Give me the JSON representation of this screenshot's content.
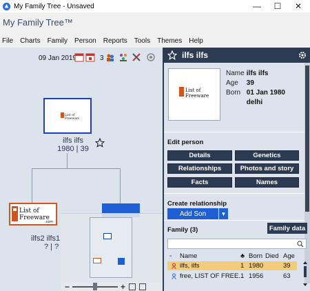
{
  "window": {
    "title": "My Family Tree - Unsaved",
    "controls": {
      "minimize": "—",
      "maximize": "☐",
      "close": "✕"
    }
  },
  "app": {
    "title": "My Family Tree™"
  },
  "menu": [
    "File",
    "Charts",
    "Family",
    "Person",
    "Reports",
    "Tools",
    "Themes",
    "Help"
  ],
  "toolbar": {
    "date": "09 Jan 2019",
    "count": "3",
    "icons": [
      "calendar-icon",
      "calendar-day-icon",
      "people-icon",
      "family-icon",
      "tools-icon",
      "settings-wheel-icon"
    ]
  },
  "tree": {
    "main_node": {
      "name": "ilfs ilfs",
      "years": "1980 | 39"
    },
    "second_node": {
      "name": "ilfs2 ilfs1",
      "years": "? | ?"
    },
    "logo_text": {
      "line1": "List of",
      "line2": "Freeware",
      "line3": ".com"
    }
  },
  "panel": {
    "person_name": "ilfs ilfs",
    "details": [
      {
        "key": "Name",
        "value": "ilfs ilfs"
      },
      {
        "key": "Age",
        "value": "39"
      },
      {
        "key": "Born",
        "value": "01 Jan 1980"
      },
      {
        "key": "",
        "value": "delhi"
      }
    ],
    "edit_person_title": "Edit person",
    "edit_buttons": [
      "Details",
      "Genetics",
      "Relationships",
      "Photos and story",
      "Facts",
      "Names"
    ],
    "create_relationship_title": "Create relationship",
    "add_son_label": "Add Son",
    "family_title": "Family (3)",
    "family_data_button": "Family data",
    "table": {
      "headers": [
        "Name",
        "Born",
        "Died",
        "Age"
      ],
      "rows": [
        {
          "name": "ilfs, ilfs",
          "num": "1",
          "born": "1980",
          "died": "",
          "age": "39",
          "selected": true
        },
        {
          "name": "free, LIST OF FREE...",
          "num": "1",
          "born": "1956",
          "died": "",
          "age": "63",
          "selected": false
        }
      ]
    }
  },
  "colors": {
    "panel_dark": "#2c3a52",
    "accent_blue": "#1f5fd6",
    "selected_row": "#f2cc7a",
    "canvas_bg": "#dce3ec"
  }
}
